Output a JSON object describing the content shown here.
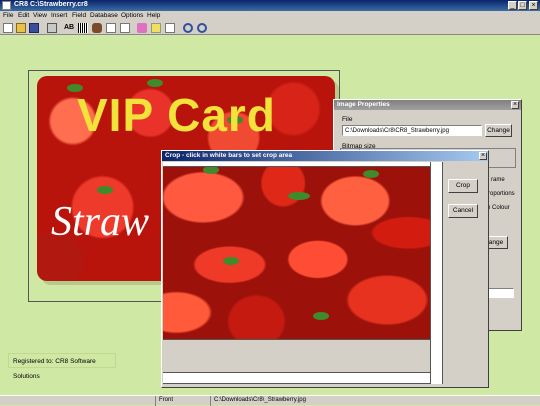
{
  "window": {
    "title": "CR8 C:\\Strawberry.cr8"
  },
  "menu": [
    "File",
    "Edit",
    "View",
    "Insert",
    "Field",
    "Database",
    "Options",
    "Help"
  ],
  "toolbar_icons": [
    "new-icon",
    "open-icon",
    "save-icon",
    "print-icon",
    "text-icon",
    "barcode-icon",
    "image-icon",
    "photo-icon",
    "shape-icon",
    "database-icon",
    "pencil-icon",
    "zoom-in-icon",
    "zoom-out-icon"
  ],
  "card": {
    "title": "VIP Card",
    "subtitle": "Straw"
  },
  "image_properties": {
    "title": "Image Properties",
    "file_label": "File",
    "file_path": "C:\\Downloads\\Cr8\\CR8_Strawberry.jpg",
    "change_label": "Change",
    "bitmap_size_label": "Bitmap size",
    "frame_label": "rame",
    "proportions_label": "roportions",
    "colour_label": "n Colour",
    "change2_label": "ange"
  },
  "crop": {
    "title": "Crop - click in white bars to set crop area",
    "crop_button": "Crop",
    "cancel_button": "Cancel"
  },
  "registration": "Registered to: CR8 Software Solutions",
  "status": {
    "side": "Front",
    "path": "C:\\Downloads\\Cr8\\_Strawberry.jpg"
  },
  "colors": {
    "background": "#cfe8a4",
    "card_title": "#f2e23a",
    "dialog": "#d4d0c8"
  }
}
